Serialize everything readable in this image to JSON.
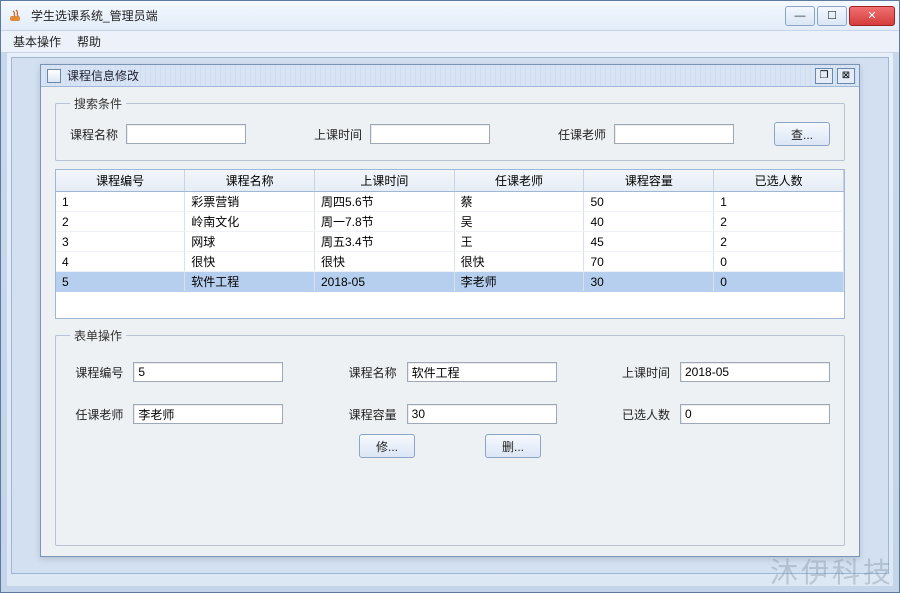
{
  "window": {
    "title": "学生选课系统_管理员端"
  },
  "menu": {
    "basic": "基本操作",
    "help": "帮助"
  },
  "internal": {
    "title": "课程信息修改"
  },
  "search": {
    "legend": "搜索条件",
    "courseNameLabel": "课程名称",
    "courseNameValue": "",
    "timeLabel": "上课时间",
    "timeValue": "",
    "teacherLabel": "任课老师",
    "teacherValue": "",
    "searchBtn": "查..."
  },
  "table": {
    "headers": [
      "课程编号",
      "课程名称",
      "上课时间",
      "任课老师",
      "课程容量",
      "已选人数"
    ],
    "rows": [
      {
        "c0": "1",
        "c1": "彩票营销",
        "c2": "周四5.6节",
        "c3": "蔡",
        "c4": "50",
        "c5": "1",
        "selected": false
      },
      {
        "c0": "2",
        "c1": "岭南文化",
        "c2": "周一7.8节",
        "c3": "吴",
        "c4": "40",
        "c5": "2",
        "selected": false
      },
      {
        "c0": "3",
        "c1": "网球",
        "c2": "周五3.4节",
        "c3": "王",
        "c4": "45",
        "c5": "2",
        "selected": false
      },
      {
        "c0": "4",
        "c1": "很快",
        "c2": "很快",
        "c3": "很快",
        "c4": "70",
        "c5": "0",
        "selected": false
      },
      {
        "c0": "5",
        "c1": "软件工程",
        "c2": "2018-05",
        "c3": "李老师",
        "c4": "30",
        "c5": "0",
        "selected": true
      }
    ]
  },
  "form": {
    "legend": "表单操作",
    "id_label": "课程编号",
    "id_value": "5",
    "name_label": "课程名称",
    "name_value": "软件工程",
    "time_label": "上课时间",
    "time_value": "2018-05",
    "teacher_label": "任课老师",
    "teacher_value": "李老师",
    "capacity_label": "课程容量",
    "capacity_value": "30",
    "selected_label": "已选人数",
    "selected_value": "0",
    "editBtn": "修...",
    "deleteBtn": "删..."
  },
  "watermark": "沐伊科技"
}
